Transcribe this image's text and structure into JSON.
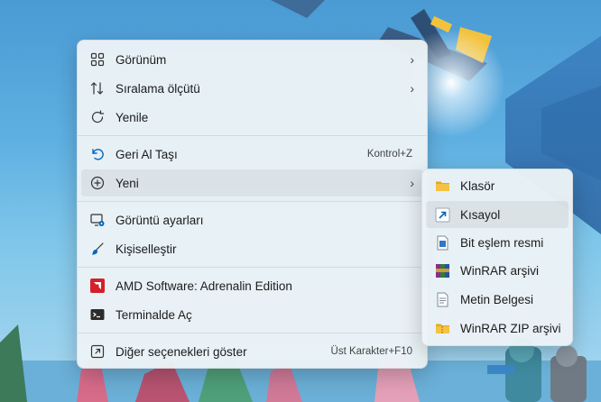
{
  "main_menu": {
    "items": [
      {
        "label": "Görünüm",
        "icon": "grid-icon",
        "submenu": true
      },
      {
        "label": "Sıralama ölçütü",
        "icon": "sort-icon",
        "submenu": true
      },
      {
        "label": "Yenile",
        "icon": "refresh-icon"
      },
      {
        "label": "Geri Al Taşı",
        "icon": "undo-icon",
        "shortcut": "Kontrol+Z"
      },
      {
        "label": "Yeni",
        "icon": "add-circle-icon",
        "submenu": true
      },
      {
        "label": "Görüntü ayarları",
        "icon": "display-settings-icon"
      },
      {
        "label": "Kişiselleştir",
        "icon": "brush-icon"
      },
      {
        "label": "AMD Software: Adrenalin Edition",
        "icon": "amd-icon"
      },
      {
        "label": "Terminalde Aç",
        "icon": "terminal-icon"
      },
      {
        "label": "Diğer seçenekleri göster",
        "icon": "more-options-icon",
        "shortcut": "Üst Karakter+F10"
      }
    ]
  },
  "sub_menu": {
    "items": [
      {
        "label": "Klasör",
        "icon": "folder-icon"
      },
      {
        "label": "Kısayol",
        "icon": "shortcut-icon"
      },
      {
        "label": "Bit eşlem resmi",
        "icon": "bitmap-icon"
      },
      {
        "label": "WinRAR arşivi",
        "icon": "winrar-icon"
      },
      {
        "label": "Metin Belgesi",
        "icon": "text-document-icon"
      },
      {
        "label": "WinRAR ZIP arşivi",
        "icon": "winrar-zip-icon"
      }
    ]
  },
  "colors": {
    "accent": "#0067c0",
    "amd_red": "#d4202a",
    "folder": "#f5c242"
  }
}
